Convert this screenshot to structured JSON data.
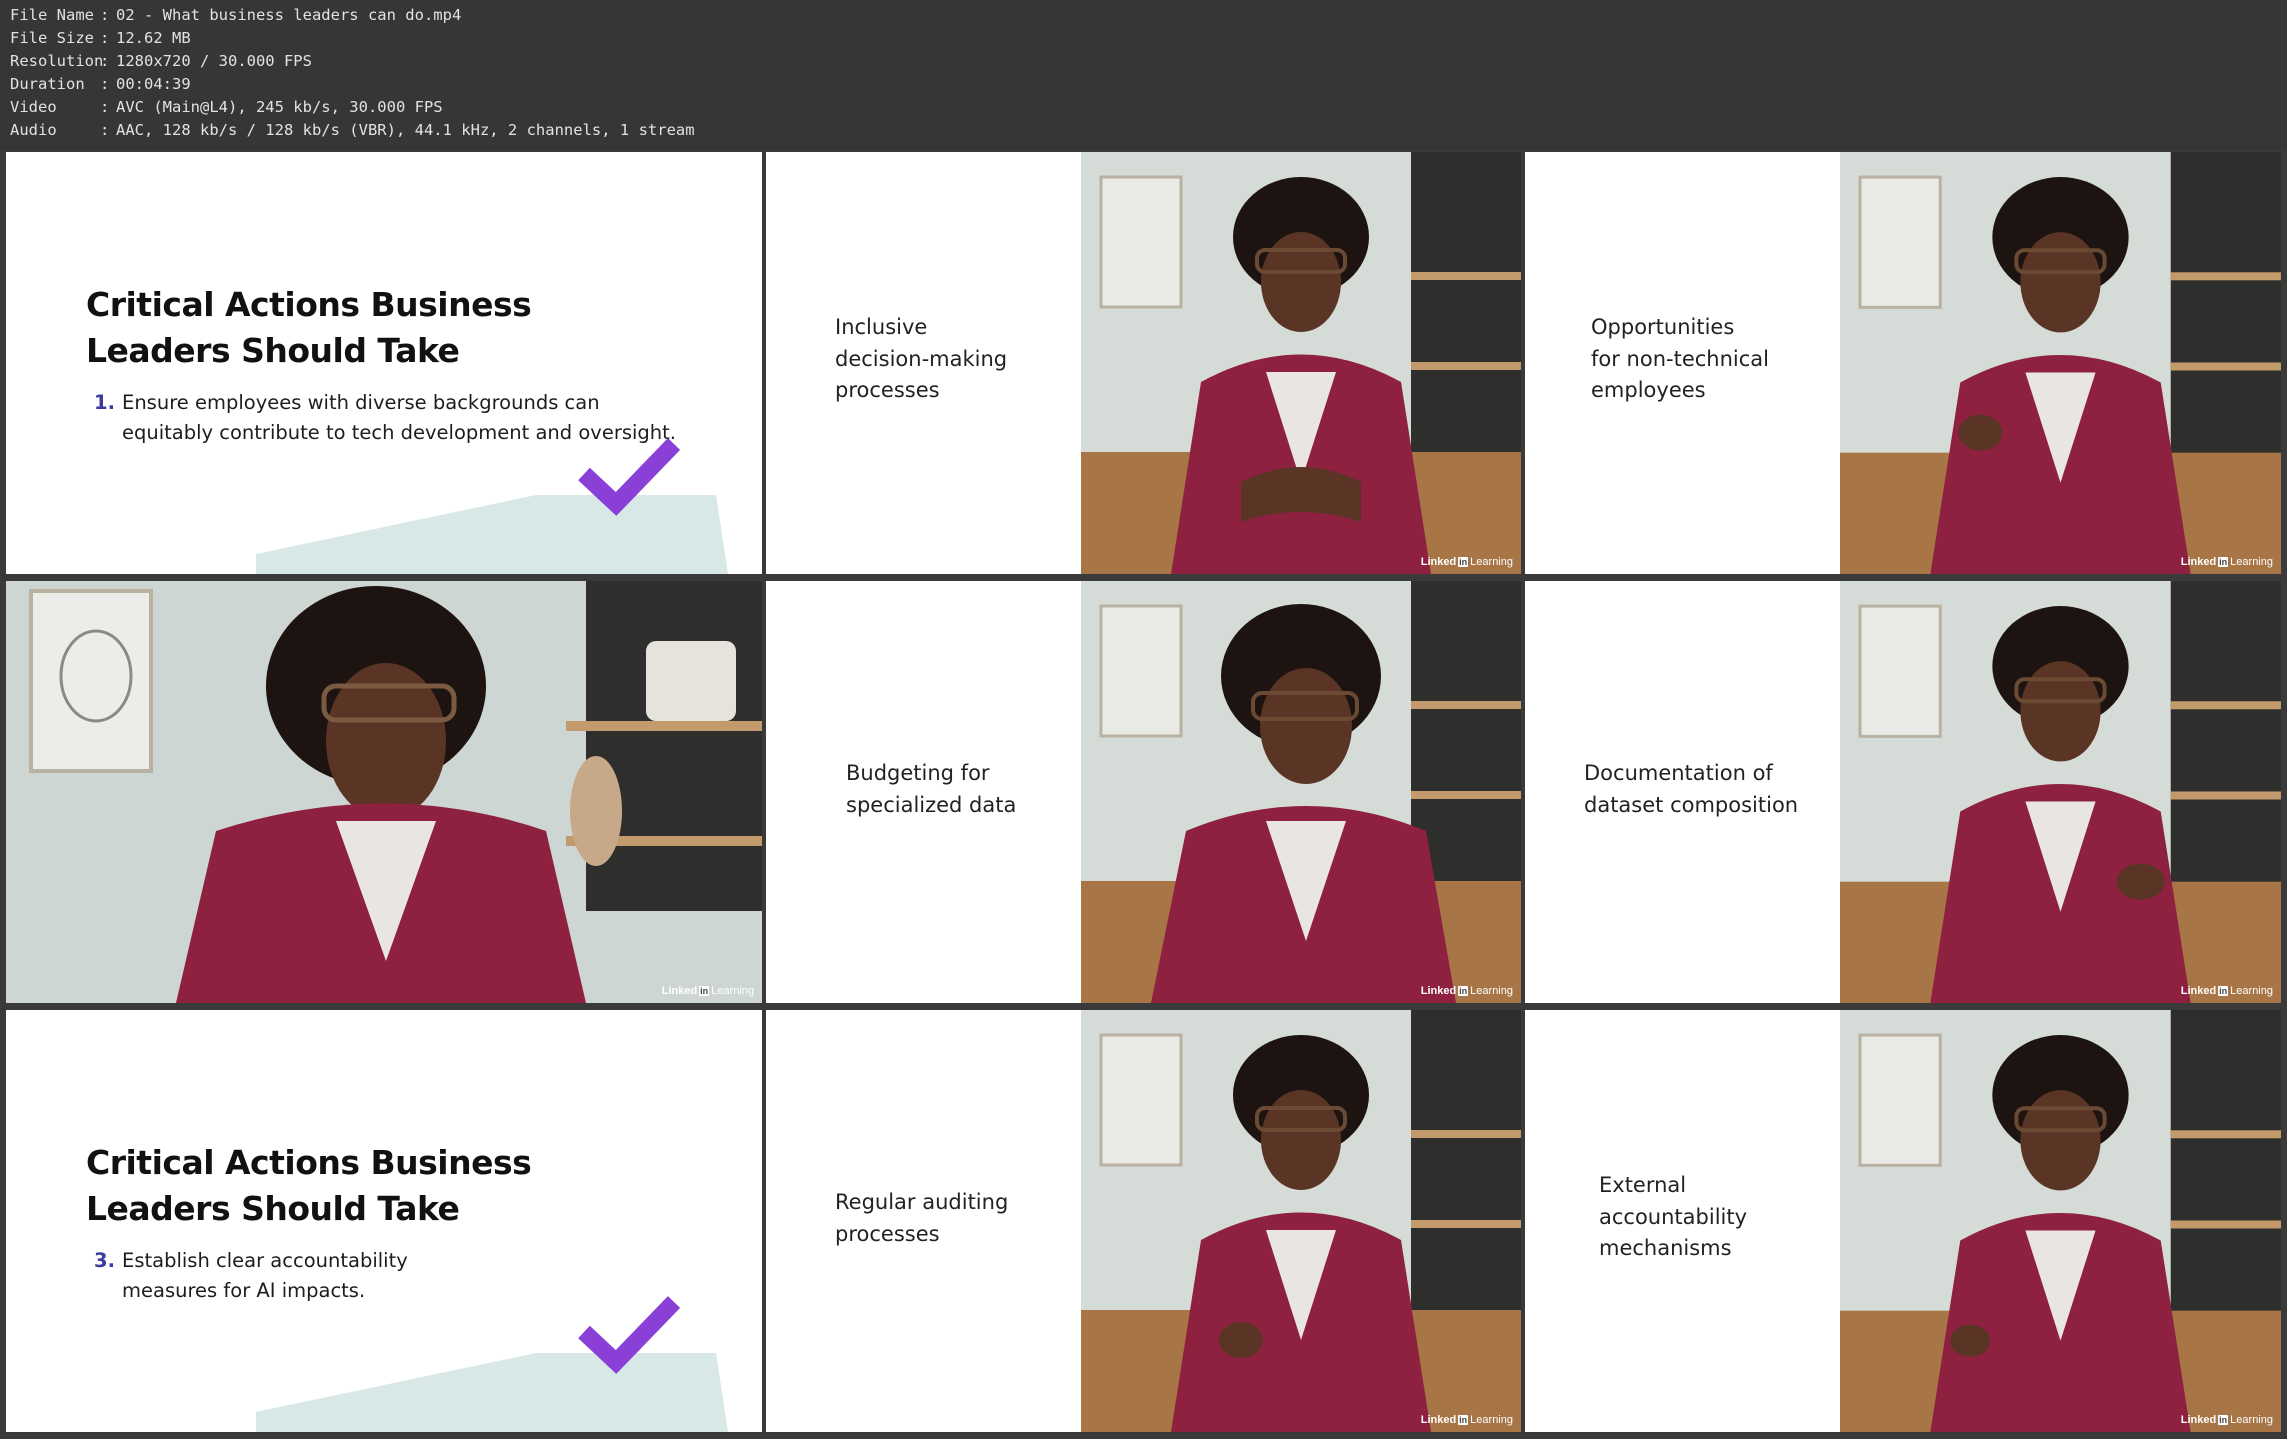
{
  "info": {
    "rows": [
      {
        "key": "File Name",
        "sep": ":",
        "value": "02 - What business leaders can do.mp4"
      },
      {
        "key": "File Size",
        "sep": ":",
        "value": "12.62 MB"
      },
      {
        "key": "Resolution",
        "sep": ":",
        "value": "1280x720 / 30.000 FPS"
      },
      {
        "key": "Duration",
        "sep": ":",
        "value": "00:04:39"
      },
      {
        "key": "Video",
        "sep": ":",
        "value": "AVC (Main@L4), 245 kb/s, 30.000 FPS"
      },
      {
        "key": "Audio",
        "sep": ":",
        "value": "AAC, 128 kb/s / 128 kb/s (VBR), 44.1 kHz, 2 channels, 1 stream"
      }
    ]
  },
  "thumbnails": {
    "slide1": {
      "heading": "Critical Actions Business Leaders Should Take",
      "number": "1.",
      "text": "Ensure employees with diverse backgrounds can equitably contribute to tech development and oversight."
    },
    "slide2": {
      "heading": "Critical Actions Business Leaders Should Take",
      "number": "3.",
      "text": "Establish clear accountability measures for AI impacts."
    },
    "captions": {
      "c1": "Inclusive\ndecision-making\nprocesses",
      "c2": "Opportunities\nfor non-technical\nemployees",
      "c3": "Budgeting for\nspecialized data",
      "c4": "Documentation of\ndataset composition",
      "c5": "Regular auditing\nprocesses",
      "c6": "External\naccountability\nmechanisms"
    },
    "watermark": {
      "brand": "Linked",
      "in": "in",
      "suffix": "Learning"
    }
  },
  "colors": {
    "check": "#8a3fd6",
    "blazer": "#8e2140",
    "hill": "#d7e8e6"
  }
}
